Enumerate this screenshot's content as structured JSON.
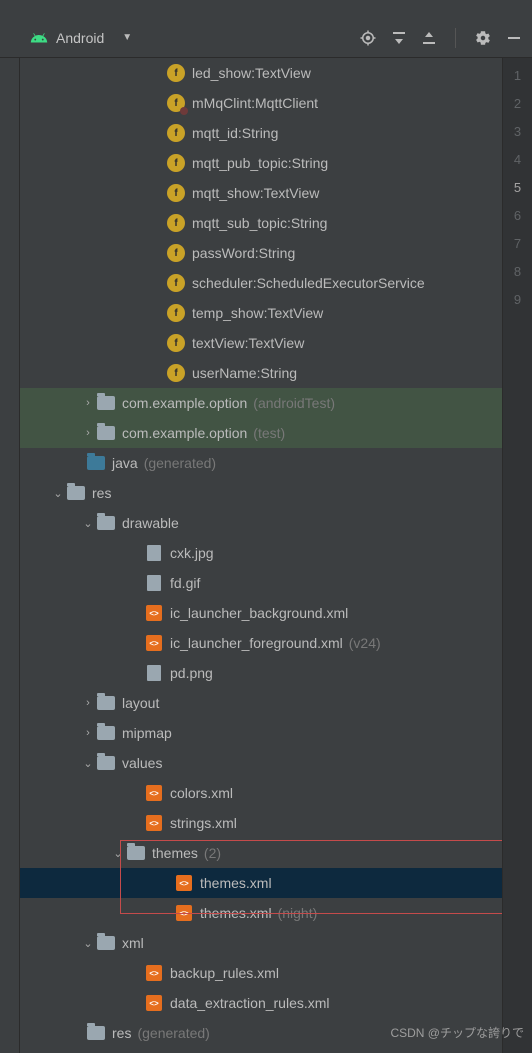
{
  "header": {
    "view_label": "Android"
  },
  "gutter": {
    "lines": [
      1,
      2,
      3,
      4,
      5,
      6,
      7,
      8,
      9
    ],
    "active": 5
  },
  "watermark": "CSDN @チップな誇りで",
  "tree": {
    "fields": [
      {
        "name": "led_show",
        "type": "TextView"
      },
      {
        "name": "mMqClint",
        "type": "MqttClient",
        "private": true
      },
      {
        "name": "mqtt_id",
        "type": "String"
      },
      {
        "name": "mqtt_pub_topic",
        "type": "String"
      },
      {
        "name": "mqtt_show",
        "type": "TextView"
      },
      {
        "name": "mqtt_sub_topic",
        "type": "String"
      },
      {
        "name": "passWord",
        "type": "String"
      },
      {
        "name": "scheduler",
        "type": "ScheduledExecutorService"
      },
      {
        "name": "temp_show",
        "type": "TextView"
      },
      {
        "name": "textView",
        "type": "TextView"
      },
      {
        "name": "userName",
        "type": "String"
      }
    ],
    "packages": [
      {
        "name": "com.example.option",
        "suffix": "(androidTest)"
      },
      {
        "name": "com.example.option",
        "suffix": "(test)"
      }
    ],
    "java_generated": {
      "label": "java",
      "suffix": "(generated)"
    },
    "res": {
      "label": "res",
      "drawable": {
        "label": "drawable",
        "items": [
          {
            "name": "cxk.jpg",
            "type": "img"
          },
          {
            "name": "fd.gif",
            "type": "img"
          },
          {
            "name": "ic_launcher_background.xml",
            "type": "xml"
          },
          {
            "name": "ic_launcher_foreground.xml",
            "type": "xml",
            "suffix": "(v24)"
          },
          {
            "name": "pd.png",
            "type": "img"
          }
        ]
      },
      "layout": {
        "label": "layout"
      },
      "mipmap": {
        "label": "mipmap"
      },
      "values": {
        "label": "values",
        "items": [
          {
            "name": "colors.xml"
          },
          {
            "name": "strings.xml"
          }
        ],
        "themes": {
          "label": "themes",
          "suffix": "(2)",
          "items": [
            {
              "name": "themes.xml",
              "selected": true
            },
            {
              "name": "themes.xml",
              "suffix": "(night)"
            }
          ]
        }
      },
      "xml": {
        "label": "xml",
        "items": [
          {
            "name": "backup_rules.xml"
          },
          {
            "name": "data_extraction_rules.xml"
          }
        ]
      }
    },
    "res_generated": {
      "label": "res",
      "suffix": "(generated)"
    }
  }
}
